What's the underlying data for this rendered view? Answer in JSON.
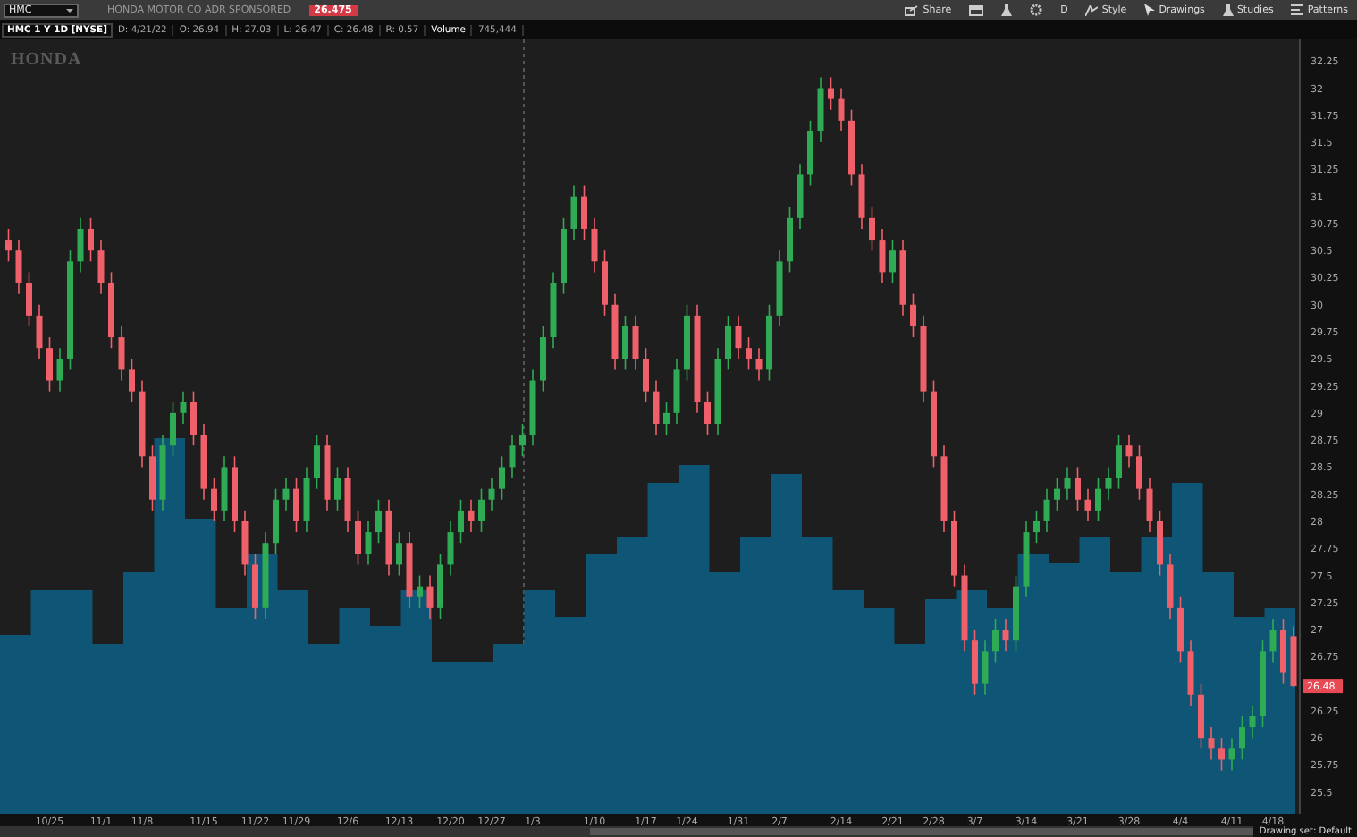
{
  "toolbar": {
    "symbol": "HMC",
    "company": "HONDA MOTOR CO ADR SPONSORED",
    "last_price": "26.475",
    "actions": [
      "Share",
      "D",
      "Style",
      "Drawings",
      "Studies",
      "Patterns"
    ]
  },
  "info_bar": {
    "title": "HMC 1 Y 1D [NYSE]",
    "fields": [
      "D: 4/21/22",
      "O: 26.94",
      "H: 27.03",
      "L: 26.47",
      "C: 26.48",
      "R: 0.57"
    ],
    "volume_label": "Volume",
    "volume": "745,444"
  },
  "logo": "HONDA",
  "chart": {
    "price_tag": "26.48",
    "chart_data": {
      "type": "candlestick",
      "ylim": [
        25.3,
        32.45
      ],
      "yticks": [
        32.25,
        32,
        31.75,
        31.5,
        31.25,
        31,
        30.75,
        30.5,
        30.25,
        30,
        29.75,
        29.5,
        29.25,
        29,
        28.75,
        28.5,
        28.25,
        28,
        27.75,
        27.5,
        27.25,
        27,
        26.75,
        26.25,
        26,
        25.75,
        25.5
      ],
      "categories": [
        null,
        null,
        null,
        null,
        "10/25",
        null,
        null,
        null,
        null,
        "11/1",
        null,
        null,
        null,
        "11/8",
        null,
        null,
        null,
        null,
        null,
        "11/15",
        null,
        null,
        null,
        null,
        "11/22",
        null,
        null,
        null,
        "11/29",
        null,
        null,
        null,
        null,
        "12/6",
        null,
        null,
        null,
        null,
        "12/13",
        null,
        null,
        null,
        null,
        "12/20",
        null,
        null,
        null,
        "12/27",
        null,
        null,
        null,
        "1/3",
        null,
        null,
        null,
        null,
        null,
        "1/10",
        null,
        null,
        null,
        null,
        "1/17",
        null,
        null,
        null,
        "1/24",
        null,
        null,
        null,
        null,
        "1/31",
        null,
        null,
        null,
        "2/7",
        null,
        null,
        null,
        null,
        null,
        "2/14",
        null,
        null,
        null,
        null,
        "2/21",
        null,
        null,
        null,
        "2/28",
        null,
        null,
        null,
        "3/7",
        null,
        null,
        null,
        null,
        "3/14",
        null,
        null,
        null,
        null,
        "3/21",
        null,
        null,
        null,
        null,
        "3/28",
        null,
        null,
        null,
        null,
        "4/4",
        null,
        null,
        null,
        null,
        "4/11",
        null,
        null,
        null,
        "4/18",
        null,
        null
      ],
      "ohlc": [
        [
          30.6,
          30.7,
          30.4,
          30.5
        ],
        [
          30.5,
          30.6,
          30.1,
          30.2
        ],
        [
          30.2,
          30.3,
          29.8,
          29.9
        ],
        [
          29.9,
          30.0,
          29.5,
          29.6
        ],
        [
          29.6,
          29.7,
          29.2,
          29.3
        ],
        [
          29.3,
          29.6,
          29.2,
          29.5
        ],
        [
          29.5,
          30.5,
          29.4,
          30.4
        ],
        [
          30.4,
          30.8,
          30.3,
          30.7
        ],
        [
          30.7,
          30.8,
          30.4,
          30.5
        ],
        [
          30.5,
          30.6,
          30.1,
          30.2
        ],
        [
          30.2,
          30.3,
          29.6,
          29.7
        ],
        [
          29.7,
          29.8,
          29.3,
          29.4
        ],
        [
          29.4,
          29.5,
          29.1,
          29.2
        ],
        [
          29.2,
          29.3,
          28.5,
          28.6
        ],
        [
          28.6,
          28.7,
          28.1,
          28.2
        ],
        [
          28.2,
          28.8,
          28.1,
          28.7
        ],
        [
          28.7,
          29.1,
          28.6,
          29.0
        ],
        [
          29.0,
          29.2,
          28.9,
          29.1
        ],
        [
          29.1,
          29.2,
          28.7,
          28.8
        ],
        [
          28.8,
          28.9,
          28.2,
          28.3
        ],
        [
          28.3,
          28.4,
          28.0,
          28.1
        ],
        [
          28.1,
          28.6,
          28.0,
          28.5
        ],
        [
          28.5,
          28.6,
          27.9,
          28.0
        ],
        [
          28.0,
          28.1,
          27.5,
          27.6
        ],
        [
          27.6,
          27.7,
          27.1,
          27.2
        ],
        [
          27.2,
          27.9,
          27.1,
          27.8
        ],
        [
          27.8,
          28.3,
          27.7,
          28.2
        ],
        [
          28.2,
          28.4,
          28.1,
          28.3
        ],
        [
          28.3,
          28.4,
          27.9,
          28.0
        ],
        [
          28.0,
          28.5,
          27.9,
          28.4
        ],
        [
          28.4,
          28.8,
          28.3,
          28.7
        ],
        [
          28.7,
          28.8,
          28.1,
          28.2
        ],
        [
          28.2,
          28.5,
          28.1,
          28.4
        ],
        [
          28.4,
          28.5,
          27.9,
          28.0
        ],
        [
          28.0,
          28.1,
          27.6,
          27.7
        ],
        [
          27.7,
          28.0,
          27.6,
          27.9
        ],
        [
          27.9,
          28.2,
          27.8,
          28.1
        ],
        [
          28.1,
          28.2,
          27.5,
          27.6
        ],
        [
          27.6,
          27.9,
          27.5,
          27.8
        ],
        [
          27.8,
          27.9,
          27.2,
          27.3
        ],
        [
          27.3,
          27.5,
          27.2,
          27.4
        ],
        [
          27.4,
          27.5,
          27.1,
          27.2
        ],
        [
          27.2,
          27.7,
          27.1,
          27.6
        ],
        [
          27.6,
          28.0,
          27.5,
          27.9
        ],
        [
          27.9,
          28.2,
          27.8,
          28.1
        ],
        [
          28.1,
          28.2,
          27.9,
          28.0
        ],
        [
          28.0,
          28.3,
          27.9,
          28.2
        ],
        [
          28.2,
          28.4,
          28.1,
          28.3
        ],
        [
          28.3,
          28.6,
          28.2,
          28.5
        ],
        [
          28.5,
          28.8,
          28.4,
          28.7
        ],
        [
          28.7,
          28.9,
          28.6,
          28.8
        ],
        [
          28.8,
          29.4,
          28.7,
          29.3
        ],
        [
          29.3,
          29.8,
          29.2,
          29.7
        ],
        [
          29.7,
          30.3,
          29.6,
          30.2
        ],
        [
          30.2,
          30.8,
          30.1,
          30.7
        ],
        [
          30.7,
          31.1,
          30.6,
          31.0
        ],
        [
          31.0,
          31.1,
          30.6,
          30.7
        ],
        [
          30.7,
          30.8,
          30.3,
          30.4
        ],
        [
          30.4,
          30.5,
          29.9,
          30.0
        ],
        [
          30.0,
          30.1,
          29.4,
          29.5
        ],
        [
          29.5,
          29.9,
          29.4,
          29.8
        ],
        [
          29.8,
          29.9,
          29.4,
          29.5
        ],
        [
          29.5,
          29.6,
          29.1,
          29.2
        ],
        [
          29.2,
          29.3,
          28.8,
          28.9
        ],
        [
          28.9,
          29.1,
          28.8,
          29.0
        ],
        [
          29.0,
          29.5,
          28.9,
          29.4
        ],
        [
          29.4,
          30.0,
          29.3,
          29.9
        ],
        [
          29.9,
          30.0,
          29.0,
          29.1
        ],
        [
          29.1,
          29.2,
          28.8,
          28.9
        ],
        [
          28.9,
          29.6,
          28.8,
          29.5
        ],
        [
          29.5,
          29.9,
          29.4,
          29.8
        ],
        [
          29.8,
          29.9,
          29.5,
          29.6
        ],
        [
          29.6,
          29.7,
          29.4,
          29.5
        ],
        [
          29.5,
          29.6,
          29.3,
          29.4
        ],
        [
          29.4,
          30.0,
          29.3,
          29.9
        ],
        [
          29.9,
          30.5,
          29.8,
          30.4
        ],
        [
          30.4,
          30.9,
          30.3,
          30.8
        ],
        [
          30.8,
          31.3,
          30.7,
          31.2
        ],
        [
          31.2,
          31.7,
          31.1,
          31.6
        ],
        [
          31.6,
          32.1,
          31.5,
          32.0
        ],
        [
          32.0,
          32.1,
          31.8,
          31.9
        ],
        [
          31.9,
          32.0,
          31.6,
          31.7
        ],
        [
          31.7,
          31.8,
          31.1,
          31.2
        ],
        [
          31.2,
          31.3,
          30.7,
          30.8
        ],
        [
          30.8,
          30.9,
          30.5,
          30.6
        ],
        [
          30.6,
          30.7,
          30.2,
          30.3
        ],
        [
          30.3,
          30.6,
          30.2,
          30.5
        ],
        [
          30.5,
          30.6,
          29.9,
          30.0
        ],
        [
          30.0,
          30.1,
          29.7,
          29.8
        ],
        [
          29.8,
          29.9,
          29.1,
          29.2
        ],
        [
          29.2,
          29.3,
          28.5,
          28.6
        ],
        [
          28.6,
          28.7,
          27.9,
          28.0
        ],
        [
          28.0,
          28.1,
          27.4,
          27.5
        ],
        [
          27.5,
          27.6,
          26.8,
          26.9
        ],
        [
          26.9,
          27.0,
          26.4,
          26.5
        ],
        [
          26.5,
          26.9,
          26.4,
          26.8
        ],
        [
          26.8,
          27.1,
          26.7,
          27.0
        ],
        [
          27.0,
          27.1,
          26.8,
          26.9
        ],
        [
          26.9,
          27.5,
          26.8,
          27.4
        ],
        [
          27.4,
          28.0,
          27.3,
          27.9
        ],
        [
          27.9,
          28.1,
          27.8,
          28.0
        ],
        [
          28.0,
          28.3,
          27.9,
          28.2
        ],
        [
          28.2,
          28.4,
          28.1,
          28.3
        ],
        [
          28.3,
          28.5,
          28.2,
          28.4
        ],
        [
          28.4,
          28.5,
          28.1,
          28.2
        ],
        [
          28.2,
          28.3,
          28.0,
          28.1
        ],
        [
          28.1,
          28.4,
          28.0,
          28.3
        ],
        [
          28.3,
          28.5,
          28.2,
          28.4
        ],
        [
          28.4,
          28.8,
          28.3,
          28.7
        ],
        [
          28.7,
          28.8,
          28.5,
          28.6
        ],
        [
          28.6,
          28.7,
          28.2,
          28.3
        ],
        [
          28.3,
          28.4,
          27.9,
          28.0
        ],
        [
          28.0,
          28.1,
          27.5,
          27.6
        ],
        [
          27.6,
          27.7,
          27.1,
          27.2
        ],
        [
          27.2,
          27.3,
          26.7,
          26.8
        ],
        [
          26.8,
          26.9,
          26.3,
          26.4
        ],
        [
          26.4,
          26.5,
          25.9,
          26.0
        ],
        [
          26.0,
          26.1,
          25.8,
          25.9
        ],
        [
          25.9,
          26.0,
          25.7,
          25.8
        ],
        [
          25.8,
          26.0,
          25.7,
          25.9
        ],
        [
          25.9,
          26.2,
          25.8,
          26.1
        ],
        [
          26.1,
          26.3,
          26.0,
          26.2
        ],
        [
          26.2,
          26.9,
          26.1,
          26.8
        ],
        [
          26.8,
          27.1,
          26.7,
          27.0
        ],
        [
          27.0,
          27.1,
          26.5,
          26.6
        ],
        [
          26.94,
          27.03,
          26.47,
          26.48
        ]
      ]
    }
  },
  "status_bar": {
    "drawing_set": "Drawing set: Default"
  }
}
